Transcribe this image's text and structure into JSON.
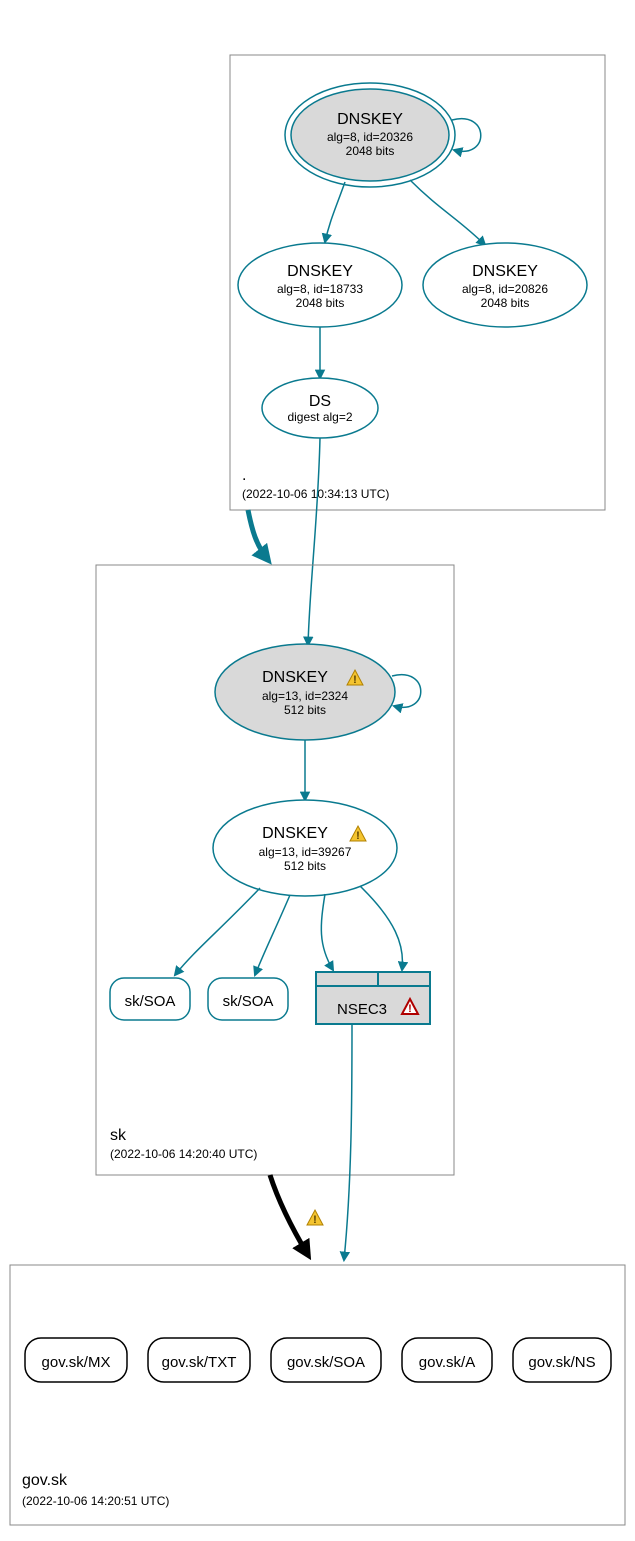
{
  "zones": {
    "root": {
      "label": ".",
      "timestamp": "(2022-10-06 10:34:13 UTC)"
    },
    "sk": {
      "label": "sk",
      "timestamp": "(2022-10-06 14:20:40 UTC)"
    },
    "gov_sk": {
      "label": "gov.sk",
      "timestamp": "(2022-10-06 14:20:51 UTC)"
    }
  },
  "nodes": {
    "root_ksk": {
      "title": "DNSKEY",
      "line2": "alg=8, id=20326",
      "line3": "2048 bits"
    },
    "root_zsk1": {
      "title": "DNSKEY",
      "line2": "alg=8, id=18733",
      "line3": "2048 bits"
    },
    "root_zsk2": {
      "title": "DNSKEY",
      "line2": "alg=8, id=20826",
      "line3": "2048 bits"
    },
    "root_ds": {
      "title": "DS",
      "line2": "digest alg=2"
    },
    "sk_ksk": {
      "title": "DNSKEY",
      "line2": "alg=13, id=2324",
      "line3": "512 bits"
    },
    "sk_zsk": {
      "title": "DNSKEY",
      "line2": "alg=13, id=39267",
      "line3": "512 bits"
    },
    "sk_soa1": {
      "label": "sk/SOA"
    },
    "sk_soa2": {
      "label": "sk/SOA"
    },
    "sk_nsec3": {
      "label": "NSEC3"
    },
    "gov_mx": {
      "label": "gov.sk/MX"
    },
    "gov_txt": {
      "label": "gov.sk/TXT"
    },
    "gov_soa": {
      "label": "gov.sk/SOA"
    },
    "gov_a": {
      "label": "gov.sk/A"
    },
    "gov_ns": {
      "label": "gov.sk/NS"
    }
  },
  "icons": {
    "warn": "⚠",
    "err": "⚠"
  }
}
